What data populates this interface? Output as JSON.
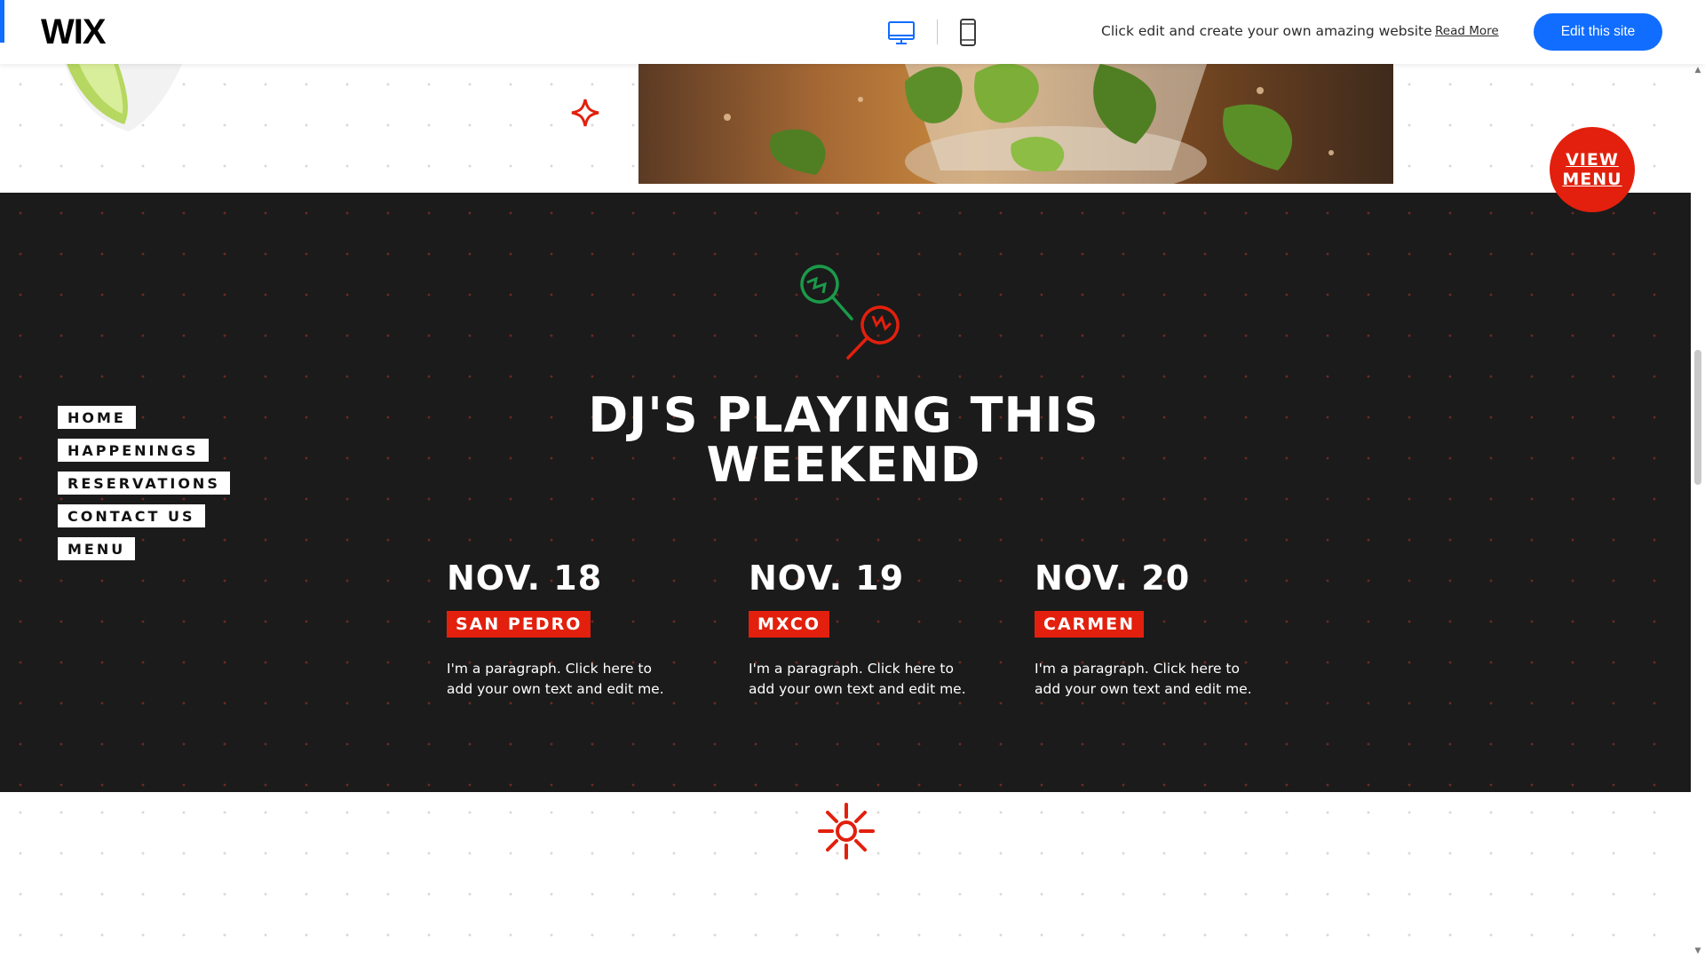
{
  "wixbar": {
    "logo": "WIX",
    "promo": "Click edit and create your own amazing website",
    "read_more": "Read More",
    "edit_button": "Edit this site",
    "accent_color": "#116dff"
  },
  "view_menu": {
    "line1": "VIEW",
    "line2": "MENU"
  },
  "nav": {
    "items": [
      "HOME",
      "HAPPENINGS",
      "RESERVATIONS",
      "CONTACT US",
      "MENU"
    ]
  },
  "headline": {
    "line1": "DJ'S PLAYING THIS",
    "line2": "WEEKEND"
  },
  "events": [
    {
      "date": "NOV. 18",
      "dj": "SAN PEDRO",
      "text": "I'm a paragraph. Click here to add your own text and edit me."
    },
    {
      "date": "NOV. 19",
      "dj": "MXCO",
      "text": "I'm a paragraph. Click here to add your own text and edit me."
    },
    {
      "date": "NOV. 20",
      "dj": "CARMEN",
      "text": "I'm a paragraph. Click here to add your own text and edit me."
    }
  ],
  "colors": {
    "brand_red": "#e2200d",
    "dark_bg": "#1b1b1b",
    "green": "#1b9a4a"
  },
  "icons": [
    "desktop-icon",
    "mobile-icon",
    "lime-decoration",
    "sparkle-icon",
    "maracas-icon",
    "sun-icon"
  ]
}
